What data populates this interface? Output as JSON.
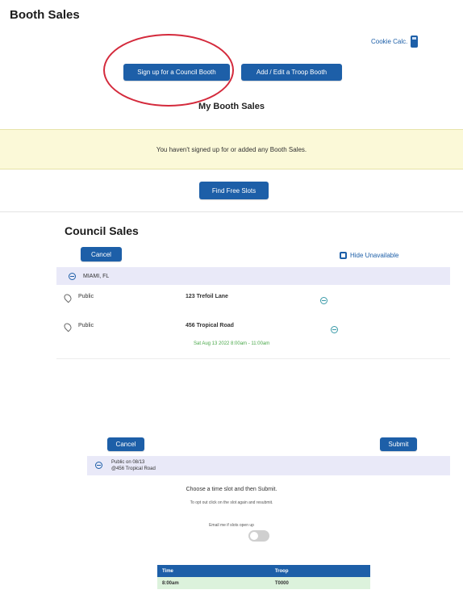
{
  "page_title": "Booth Sales",
  "header": {
    "cookie_calc_label": "Cookie Calc.",
    "signup_council_booth": "Sign up for a Council Booth",
    "add_edit_troop_booth": "Add / Edit a Troop Booth"
  },
  "my_booth_sales": {
    "heading": "My Booth Sales",
    "empty_message": "You haven't signed up for or added any Booth Sales.",
    "find_free_slots": "Find Free Slots"
  },
  "council_sales": {
    "heading": "Council Sales",
    "cancel_label": "Cancel",
    "hide_unavailable_label": "Hide Unavailable",
    "location_name": "MIAMI, FL",
    "booths": [
      {
        "type": "Public",
        "address": "123 Trefoil Lane"
      },
      {
        "type": "Public",
        "address": "456 Tropical Road",
        "timeslot": "Sat Aug 13 2022 8:00am - 11:00am"
      }
    ]
  },
  "booth_panel": {
    "cancel_label": "Cancel",
    "submit_label": "Submit",
    "selected_booth_line1": "Public on 08/13",
    "selected_booth_line2": "@456 Tropical Road",
    "instruction": "Choose a time slot and then Submit.",
    "instruction_sub": "To opt out click on the slot again and resubmit.",
    "toggle_label": "Email me if slots open up",
    "toggle_on": false,
    "table_headers": [
      "Time",
      "Troop"
    ],
    "table_rows": [
      [
        "8:00am",
        "T0000"
      ]
    ]
  },
  "colors": {
    "primary": "#1d5fa8",
    "annotation_circle": "#d42a3c",
    "notice_bg": "#fbf9d8",
    "location_bar_bg": "#e9e9f8",
    "slot_available": "#dcf2dc",
    "timeslot_text": "#4aa84a"
  }
}
